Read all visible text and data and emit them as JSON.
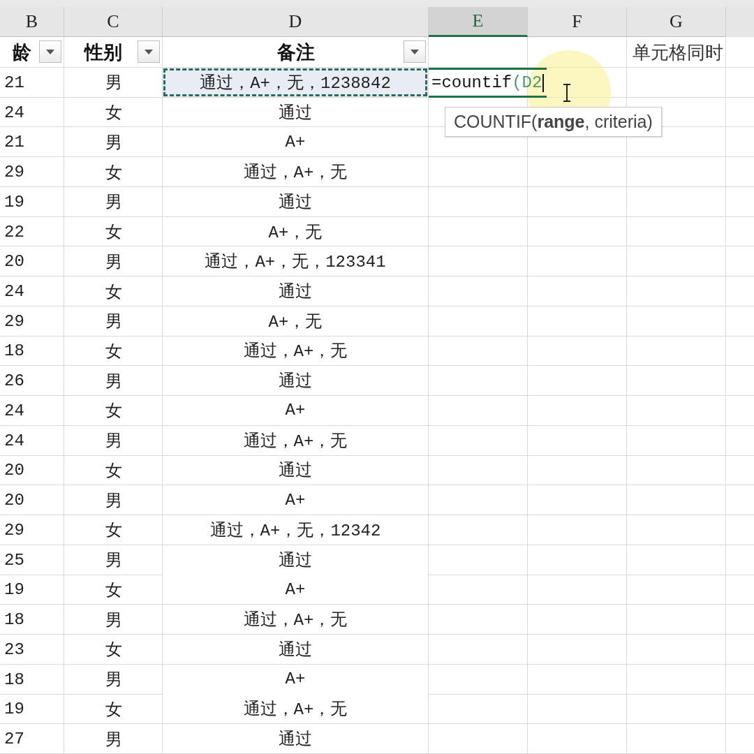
{
  "column_headers": [
    {
      "label": "B",
      "selected": false
    },
    {
      "label": "C",
      "selected": false
    },
    {
      "label": "D",
      "selected": false
    },
    {
      "label": "E",
      "selected": true
    },
    {
      "label": "F",
      "selected": false
    },
    {
      "label": "G",
      "selected": false
    }
  ],
  "header_row": [
    {
      "label": "龄",
      "filter": true
    },
    {
      "label": "性别",
      "filter": true
    },
    {
      "label": "备注",
      "filter": true
    }
  ],
  "g1_text": "单元格同时",
  "rows": [
    {
      "age": "21",
      "gender": "男",
      "note": "通过，A+，无，1238842",
      "selected": true
    },
    {
      "age": "24",
      "gender": "女",
      "note": "通过",
      "selected": false
    },
    {
      "age": "21",
      "gender": "男",
      "note": "A+",
      "selected": false
    },
    {
      "age": "29",
      "gender": "女",
      "note": "通过，A+，无",
      "selected": false
    },
    {
      "age": "19",
      "gender": "男",
      "note": "通过",
      "selected": false
    },
    {
      "age": "22",
      "gender": "女",
      "note": "A+，无",
      "selected": false
    },
    {
      "age": "20",
      "gender": "男",
      "note": "通过，A+，无，123341",
      "selected": false
    },
    {
      "age": "24",
      "gender": "女",
      "note": "通过",
      "selected": false
    },
    {
      "age": "29",
      "gender": "男",
      "note": "A+，无",
      "selected": false
    },
    {
      "age": "18",
      "gender": "女",
      "note": "通过，A+，无",
      "selected": false
    },
    {
      "age": "26",
      "gender": "男",
      "note": "通过",
      "selected": false
    },
    {
      "age": "24",
      "gender": "女",
      "note": "A+",
      "selected": false
    },
    {
      "age": "24",
      "gender": "男",
      "note": "通过，A+，无",
      "selected": false
    },
    {
      "age": "20",
      "gender": "女",
      "note": "通过",
      "selected": false
    },
    {
      "age": "20",
      "gender": "男",
      "note": "A+",
      "selected": false
    },
    {
      "age": "29",
      "gender": "女",
      "note": "通过，A+，无，12342",
      "selected": false
    },
    {
      "age": "25",
      "gender": "男",
      "note": "通过",
      "selected": false
    },
    {
      "age": "19",
      "gender": "女",
      "note": "A+",
      "selected": false
    },
    {
      "age": "18",
      "gender": "男",
      "note": "通过，A+，无",
      "selected": false
    },
    {
      "age": "23",
      "gender": "女",
      "note": "通过",
      "selected": false
    },
    {
      "age": "18",
      "gender": "男",
      "note": "A+",
      "selected": false
    },
    {
      "age": "19",
      "gender": "女",
      "note": "通过，A+，无",
      "selected": false
    },
    {
      "age": "27",
      "gender": "男",
      "note": "通过",
      "selected": false
    }
  ],
  "formula": {
    "text": "=countif",
    "reference": "(D2"
  },
  "tooltip": "COUNTIF(**range**, criteria)"
}
